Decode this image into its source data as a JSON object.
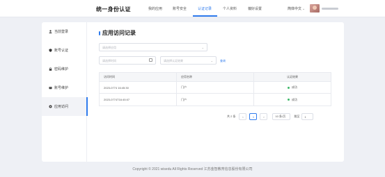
{
  "header": {
    "brand": "统一身份认证",
    "nav": [
      {
        "label": "我的应用"
      },
      {
        "label": "账号安全"
      },
      {
        "label": "认证记录"
      },
      {
        "label": "个人资料"
      },
      {
        "label": "偏好设置"
      }
    ],
    "active_nav": "认证记录",
    "language": "简体中文",
    "accent_color": "#2f7bed"
  },
  "sidebar": {
    "items": [
      {
        "label": "当前登录",
        "icon": "user-icon"
      },
      {
        "label": "账号认证",
        "icon": "shield-icon"
      },
      {
        "label": "密码维护",
        "icon": "lock-icon"
      },
      {
        "label": "账号维护",
        "icon": "account-icon"
      },
      {
        "label": "应用访问",
        "icon": "app-icon"
      }
    ],
    "active": "应用访问"
  },
  "main": {
    "title": "应用访问记录",
    "app_select_placeholder": "请选择应用",
    "date_placeholder": "请选择时间",
    "result_placeholder": "请选择认证结果",
    "query_label": "查询",
    "table": {
      "headers": [
        "访问时间",
        "应用名称",
        "认证结果"
      ],
      "rows": [
        {
          "time": "2023-0774 16:45:30",
          "app": "门户",
          "result": "成功"
        },
        {
          "time": "2023-0774T16:45:07",
          "app": "门户",
          "result": "成功"
        }
      ],
      "status_color": "#3cb868"
    },
    "pagination": {
      "total_text": "共 2 条",
      "prev": "<",
      "current_page": "1",
      "next": ">",
      "page_size": "10 条/页",
      "jump_label": "跳至",
      "jump_value": "1"
    }
  },
  "footer": {
    "text": "Copyright © 2021 wisedu All Rights Reserved 江苏金智教育信息股份有限公司"
  }
}
